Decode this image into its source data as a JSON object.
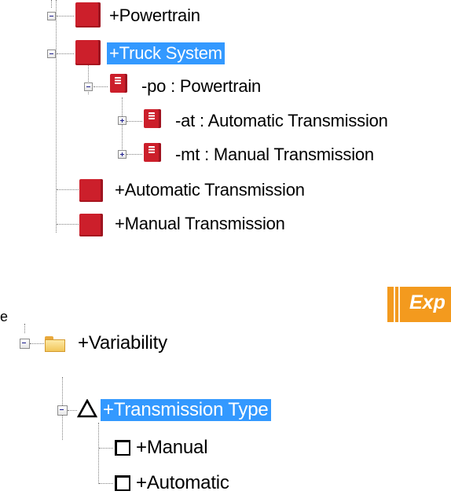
{
  "tree_top": {
    "items": [
      {
        "label": "+Powertrain",
        "icon": "block-icon",
        "selected": false
      },
      {
        "label": "+Truck System",
        "icon": "block-icon",
        "selected": true
      },
      {
        "label": "-po : Powertrain",
        "icon": "part-icon",
        "selected": false
      },
      {
        "label": "-at : Automatic Transmission",
        "icon": "part-icon",
        "selected": false
      },
      {
        "label": "-mt : Manual Transmission",
        "icon": "part-icon",
        "selected": false
      },
      {
        "label": "+Automatic Transmission",
        "icon": "block-icon",
        "selected": false
      },
      {
        "label": "+Manual Transmission",
        "icon": "block-icon",
        "selected": false
      }
    ]
  },
  "banner": {
    "text": "Exp",
    "color": "#f39a1e"
  },
  "edge_fragment": "e",
  "tree_bottom": {
    "items": [
      {
        "label": "+Variability",
        "icon": "folder-icon",
        "selected": false
      },
      {
        "label": "+Transmission Type",
        "icon": "triangle-icon",
        "selected": true
      },
      {
        "label": "+Manual",
        "icon": "variant-icon",
        "selected": false
      },
      {
        "label": "+Automatic",
        "icon": "variant-icon",
        "selected": false
      }
    ]
  },
  "colors": {
    "selection": "#3399ff",
    "block": "#cc1f2b",
    "accent": "#f39a1e"
  }
}
